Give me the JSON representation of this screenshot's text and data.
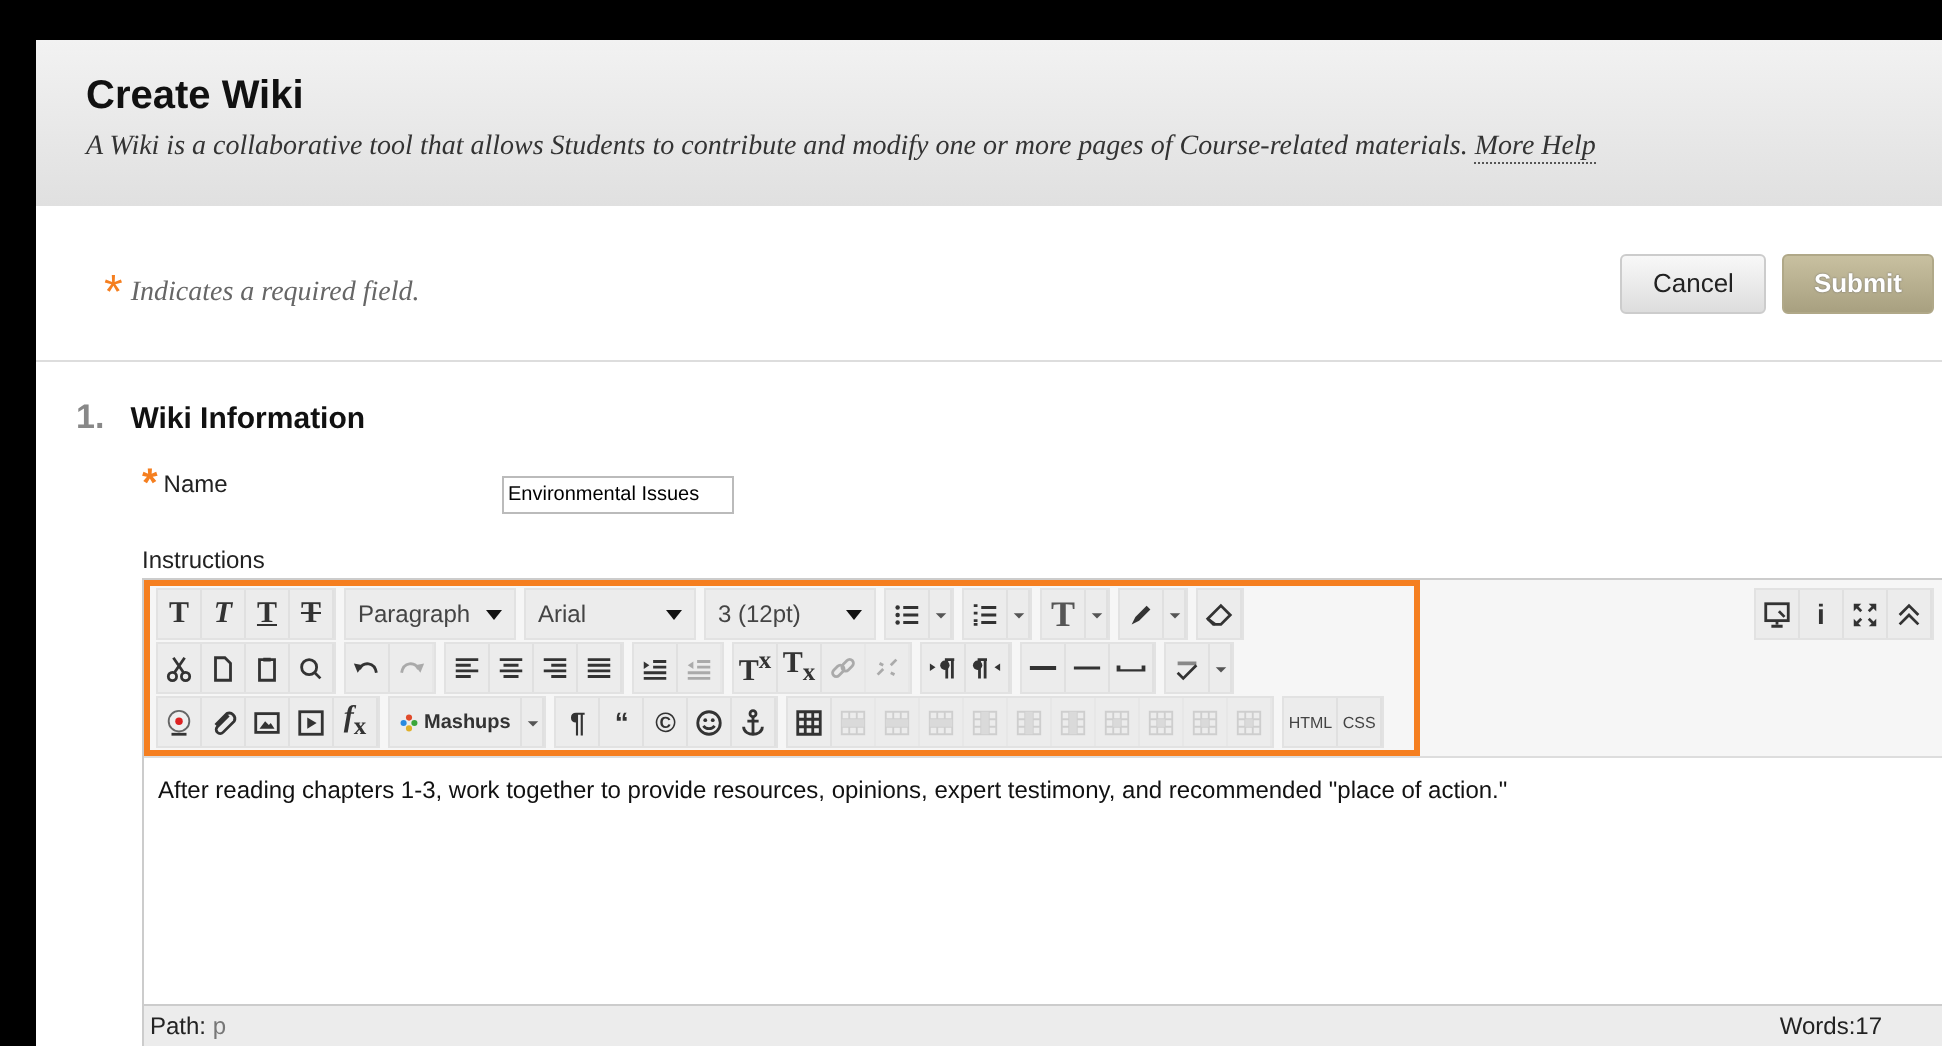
{
  "header": {
    "title": "Create Wiki",
    "description": "A Wiki is a collaborative tool that allows Students to contribute and modify one or more pages of Course-related materials.",
    "help_link": "More Help"
  },
  "required_note": {
    "mark": "*",
    "text": "Indicates a required field."
  },
  "buttons": [
    {
      "label": "Cancel",
      "kind": "secondary"
    },
    {
      "label": "Submit",
      "kind": "primary"
    }
  ],
  "section": {
    "number": "1.",
    "title": "Wiki Information"
  },
  "name_field": {
    "mark": "*",
    "label": "Name",
    "value": "Environmental Issues"
  },
  "instructions": {
    "label": "Instructions",
    "toolbar_rows": [
      [
        [
          {
            "kind": "bold",
            "text": "T",
            "disabled": false
          },
          {
            "kind": "italic",
            "text": "T",
            "disabled": false
          },
          {
            "kind": "underline",
            "text": "T",
            "disabled": false
          },
          {
            "kind": "strike",
            "text": "T",
            "disabled": false
          }
        ],
        [
          {
            "kind": "select",
            "value": "Paragraph",
            "disabled": false
          }
        ],
        [
          {
            "kind": "select",
            "value": "Arial",
            "disabled": false
          }
        ],
        [
          {
            "kind": "select",
            "value": "3 (12pt)",
            "disabled": false
          }
        ],
        [
          {
            "kind": "icon",
            "dropdown": true,
            "disabled": false
          }
        ],
        [
          {
            "kind": "icon",
            "dropdown": true,
            "disabled": false
          }
        ],
        [
          {
            "kind": "serif",
            "text": "T",
            "dropdown": true,
            "disabled": false
          }
        ],
        [
          {
            "kind": "icon",
            "dropdown": true,
            "disabled": false
          }
        ],
        [
          {
            "kind": "icon",
            "disabled": false
          }
        ]
      ],
      [
        [
          {
            "kind": "icon",
            "disabled": false
          },
          {
            "kind": "icon",
            "disabled": false
          },
          {
            "kind": "icon",
            "disabled": false
          },
          {
            "kind": "icon",
            "disabled": false
          }
        ],
        [
          {
            "kind": "icon",
            "disabled": false
          },
          {
            "kind": "icon",
            "disabled": true
          }
        ],
        [
          {
            "kind": "icon",
            "disabled": false
          },
          {
            "kind": "icon",
            "disabled": false
          },
          {
            "kind": "icon",
            "disabled": false
          },
          {
            "kind": "icon",
            "disabled": false
          }
        ],
        [
          {
            "kind": "icon",
            "disabled": false
          },
          {
            "kind": "icon",
            "disabled": true
          }
        ],
        [
          {
            "kind": "rich",
            "text": "T$^{x}$",
            "disabled": false
          },
          {
            "kind": "rich",
            "text": "T$_{x}$",
            "disabled": false
          },
          {
            "kind": "icon",
            "disabled": true
          },
          {
            "kind": "icon",
            "disabled": true
          }
        ],
        [
          {
            "kind": "icon",
            "disabled": false
          },
          {
            "kind": "icon",
            "disabled": false
          }
        ],
        [
          {
            "kind": "icon",
            "disabled": false
          },
          {
            "kind": "icon",
            "disabled": false
          },
          {
            "kind": "icon",
            "disabled": false
          }
        ],
        [
          {
            "kind": "icon",
            "dropdown": true,
            "disabled": false
          }
        ]
      ],
      [
        [
          {
            "kind": "icon",
            "disabled": false
          },
          {
            "kind": "icon",
            "disabled": false
          },
          {
            "kind": "icon",
            "disabled": false
          },
          {
            "kind": "icon",
            "disabled": false
          },
          {
            "kind": "rich",
            "text": "*f*$_{x}$",
            "disabled": false
          }
        ],
        [
          {
            "kind": "menu",
            "text": "Mashups",
            "dropdown": true,
            "disabled": false
          }
        ],
        [
          {
            "kind": "glyph",
            "text": "¶",
            "disabled": false
          },
          {
            "kind": "glyph",
            "text": "“",
            "disabled": false
          },
          {
            "kind": "glyph",
            "text": "©",
            "disabled": false
          },
          {
            "kind": "icon",
            "disabled": false
          },
          {
            "kind": "icon",
            "disabled": false
          }
        ],
        [
          {
            "kind": "icon",
            "disabled": false
          },
          {
            "kind": "icon",
            "disabled": true
          },
          {
            "kind": "icon",
            "disabled": true
          },
          {
            "kind": "icon",
            "disabled": true
          },
          {
            "kind": "icon",
            "disabled": true
          },
          {
            "kind": "icon",
            "disabled": true
          },
          {
            "kind": "icon",
            "disabled": true
          },
          {
            "kind": "icon",
            "disabled": true
          },
          {
            "kind": "icon",
            "disabled": true
          },
          {
            "kind": "icon",
            "disabled": true
          },
          {
            "kind": "icon",
            "disabled": true
          }
        ],
        [
          {
            "kind": "small",
            "text": "HTML",
            "disabled": false
          },
          {
            "kind": "small",
            "text": "CSS",
            "disabled": false
          }
        ]
      ]
    ],
    "toolbar_side": [
      {
        "kind": "icon",
        "disabled": false
      },
      {
        "kind": "glyph",
        "text": "i",
        "disabled": false
      },
      {
        "kind": "icon",
        "disabled": false
      },
      {
        "kind": "icon",
        "disabled": false
      }
    ],
    "body": "After reading chapters 1-3, work together to provide resources, opinions, expert testimony, and recommended \"place of action.\"",
    "path_label": "Path:",
    "path_value": "p",
    "word_count": "Words:17"
  }
}
